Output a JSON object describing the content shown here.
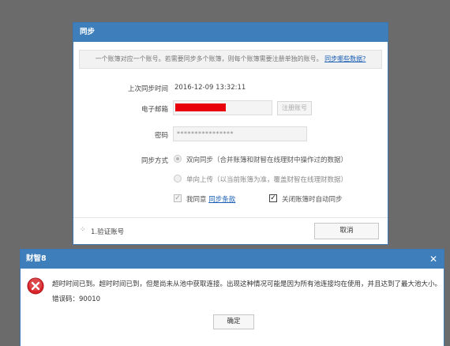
{
  "sync_dialog": {
    "title": "同步",
    "notice_text": "一个账簿对应一个账号。若需要同步多个账簿，则每个账簿需要注册单独的账号。",
    "notice_link": "同步哪些数据?",
    "last_sync_label": "上次同步时间",
    "last_sync_value": "2016-12-09 13:32:11",
    "email_label": "电子邮箱",
    "register_button": "注册账号",
    "password_label": "密码",
    "password_value": "****************",
    "sync_mode_label": "同步方式",
    "option_two_way": "双向同步（合并账簿和财智在线理财中操作过的数据）",
    "option_upload": "单向上传（以当前账簿为准，覆盖财智在线理财数据）",
    "agree_text": "我同意",
    "agree_link": "同步条款",
    "auto_sync_text": "关闭账簿时自动同步",
    "status_text": "1.验证账号",
    "cancel_button": "取消"
  },
  "error_dialog": {
    "title": "财智8",
    "close_glyph": "✕",
    "message": "超时时间已到。超时时间已到，但是尚未从池中获取连接。出现这种情况可能是因为所有池连接均在使用，并且达到了最大池大小。",
    "error_code": "错误码：90010",
    "ok_button": "确定"
  },
  "colors": {
    "titlebar": "#3d7ebb",
    "background": "#6b6b6b",
    "redacted": "#e8000a",
    "link": "#1a5fb4",
    "error_icon": "#d9252a"
  }
}
